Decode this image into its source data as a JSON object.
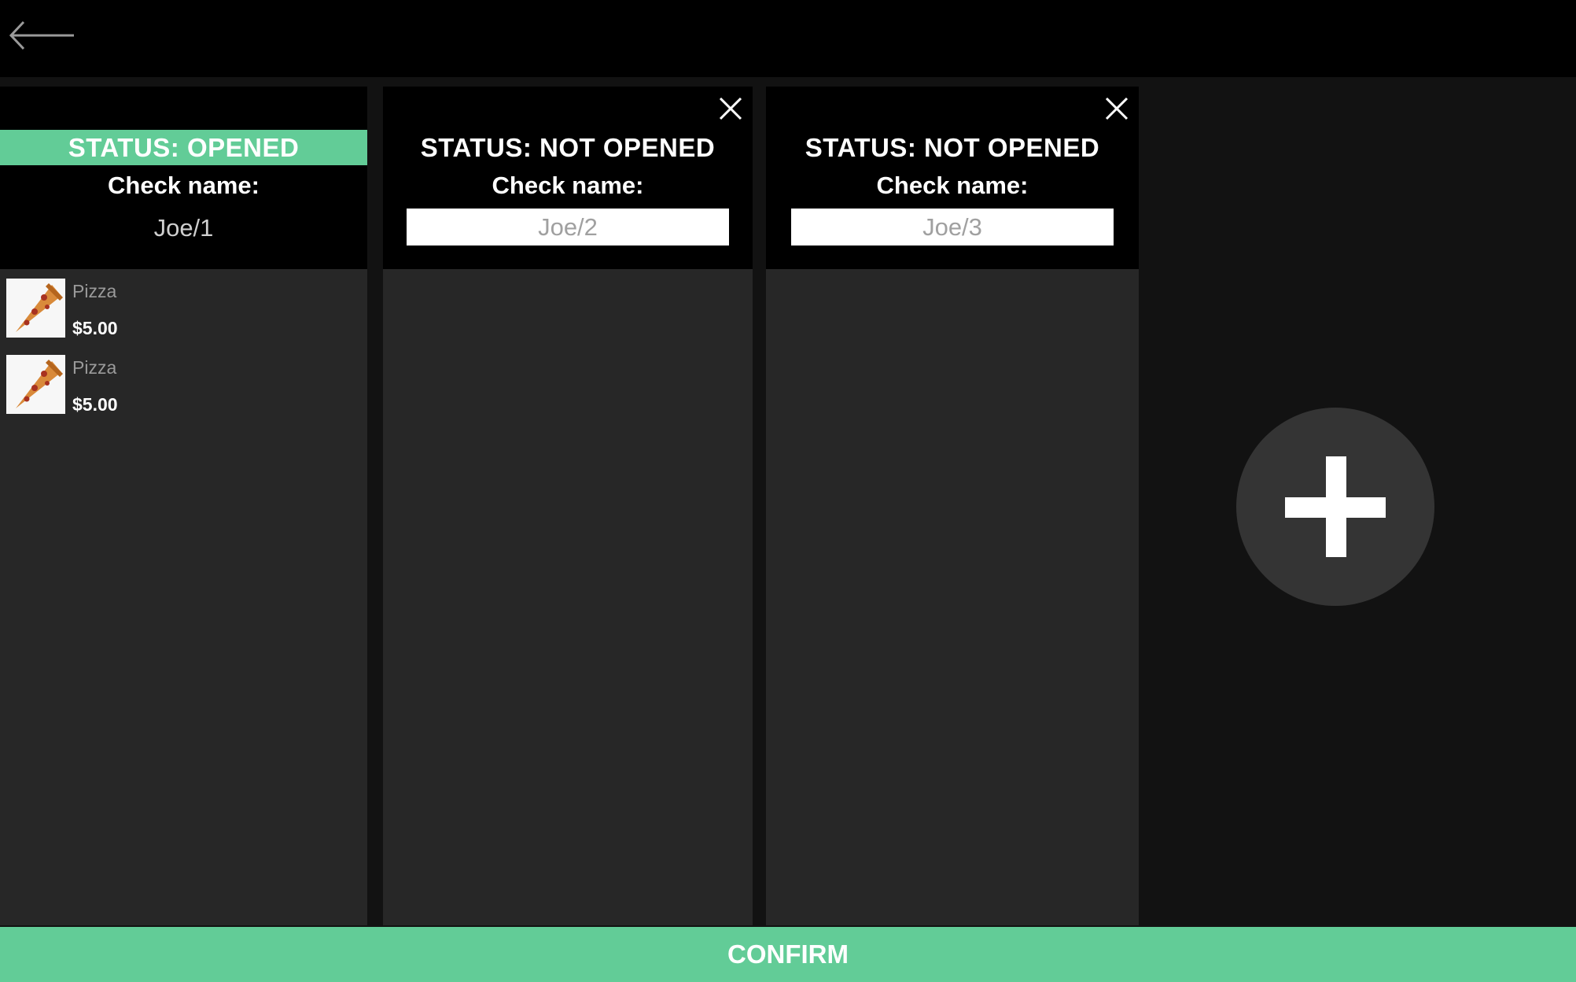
{
  "topbar": {
    "back_icon": "arrow-left-icon"
  },
  "checks": [
    {
      "status": "STATUS: OPENED",
      "status_color": "#62cc97",
      "check_name_label": "Check name:",
      "check_name": "Joe/1",
      "closable": false,
      "items": [
        {
          "name": "Pizza",
          "price": "$5.00",
          "icon": "pizza-slice-icon"
        },
        {
          "name": "Pizza",
          "price": "$5.00",
          "icon": "pizza-slice-icon"
        }
      ]
    },
    {
      "status": "STATUS: NOT OPENED",
      "check_name_label": "Check name:",
      "check_name_placeholder": "Joe/2",
      "closable": true,
      "close_icon": "close-icon",
      "items": []
    },
    {
      "status": "STATUS: NOT OPENED",
      "check_name_label": "Check name:",
      "check_name_placeholder": "Joe/3",
      "closable": true,
      "close_icon": "close-icon",
      "items": []
    }
  ],
  "add_button": {
    "icon": "plus-icon"
  },
  "footer": {
    "confirm_label": "CONFIRM",
    "confirm_color": "#62cc97"
  },
  "colors": {
    "accent": "#62cc97",
    "background": "#121212",
    "panel": "#272727",
    "header": "#000000"
  }
}
